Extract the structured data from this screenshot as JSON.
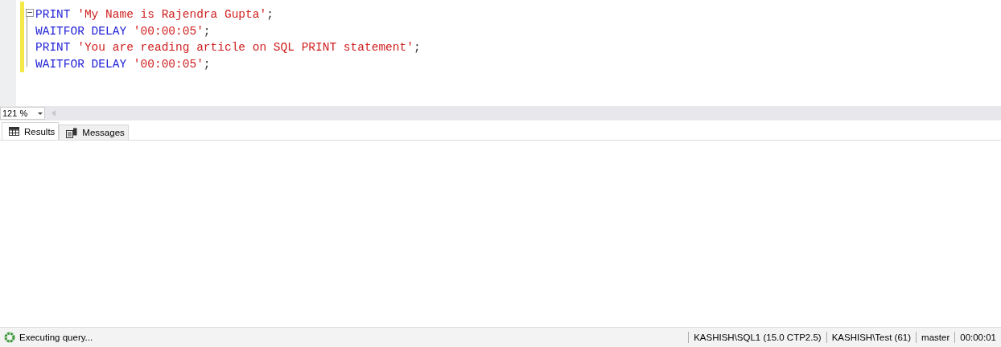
{
  "editor": {
    "lines": [
      {
        "tokens": [
          {
            "kind": "keyword",
            "text": "PRINT"
          },
          {
            "kind": "string",
            "text": " 'My Name is Rajendra Gupta'"
          },
          {
            "kind": "punct",
            "text": ";"
          }
        ]
      },
      {
        "tokens": [
          {
            "kind": "keyword",
            "text": "WAITFOR DELAY"
          },
          {
            "kind": "string",
            "text": " '00:00:05'"
          },
          {
            "kind": "punct",
            "text": ";"
          }
        ]
      },
      {
        "tokens": [
          {
            "kind": "keyword",
            "text": "PRINT"
          },
          {
            "kind": "string",
            "text": " 'You are reading article on SQL PRINT statement'"
          },
          {
            "kind": "punct",
            "text": ";"
          }
        ]
      },
      {
        "tokens": [
          {
            "kind": "keyword",
            "text": "WAITFOR DELAY"
          },
          {
            "kind": "string",
            "text": " '00:00:05'"
          },
          {
            "kind": "punct",
            "text": ";"
          }
        ]
      }
    ]
  },
  "zoom": {
    "value": "121 %"
  },
  "tabs": [
    {
      "label": "Results",
      "kind": "grid",
      "selected": true
    },
    {
      "label": "Messages",
      "kind": "messages",
      "selected": false
    }
  ],
  "status_bar": {
    "message": "Executing query...",
    "panes": [
      "KASHISH\\SQL1 (15.0 CTP2.5)",
      "KASHISH\\Test (61)",
      "master",
      "00:00:01"
    ]
  }
}
